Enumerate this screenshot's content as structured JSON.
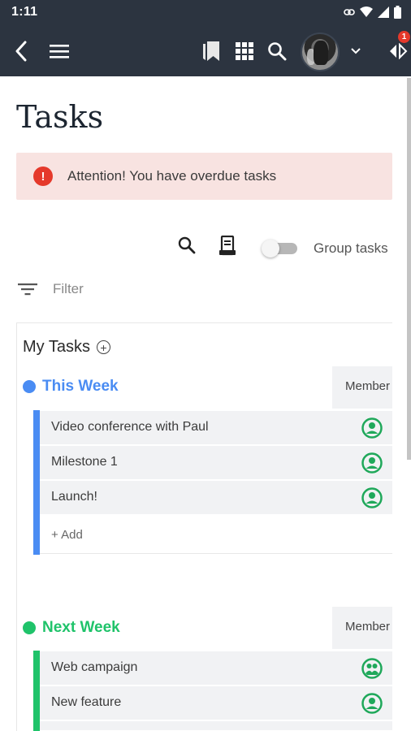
{
  "status_bar": {
    "time": "1:11"
  },
  "app_bar": {
    "icons": [
      "back-icon",
      "menu-icon",
      "bookmarks-icon",
      "apps-grid-icon",
      "search-icon",
      "chevron-down-icon",
      "notifications-icon"
    ],
    "notification_count": "1"
  },
  "page": {
    "title": "Tasks"
  },
  "alert": {
    "text": "Attention! You have overdue tasks",
    "color": "#e5392b"
  },
  "tools": {
    "group_tasks_label": "Group tasks",
    "group_tasks_enabled": false
  },
  "filter": {
    "label": "Filter"
  },
  "my_tasks": {
    "heading": "My Tasks",
    "column_header": "Member",
    "sections": [
      {
        "name": "This Week",
        "color": "#4a8cf3",
        "tasks": [
          {
            "label": "Video conference with Paul",
            "icon": "member-icon"
          },
          {
            "label": "Milestone 1",
            "icon": "member-icon"
          },
          {
            "label": "Launch!",
            "icon": "member-icon"
          }
        ],
        "add_label": "+ Add"
      },
      {
        "name": "Next Week",
        "color": "#1fc36a",
        "tasks": [
          {
            "label": "Web campaign",
            "icon": "group-icon"
          },
          {
            "label": "New feature",
            "icon": "member-icon"
          }
        ]
      }
    ]
  }
}
